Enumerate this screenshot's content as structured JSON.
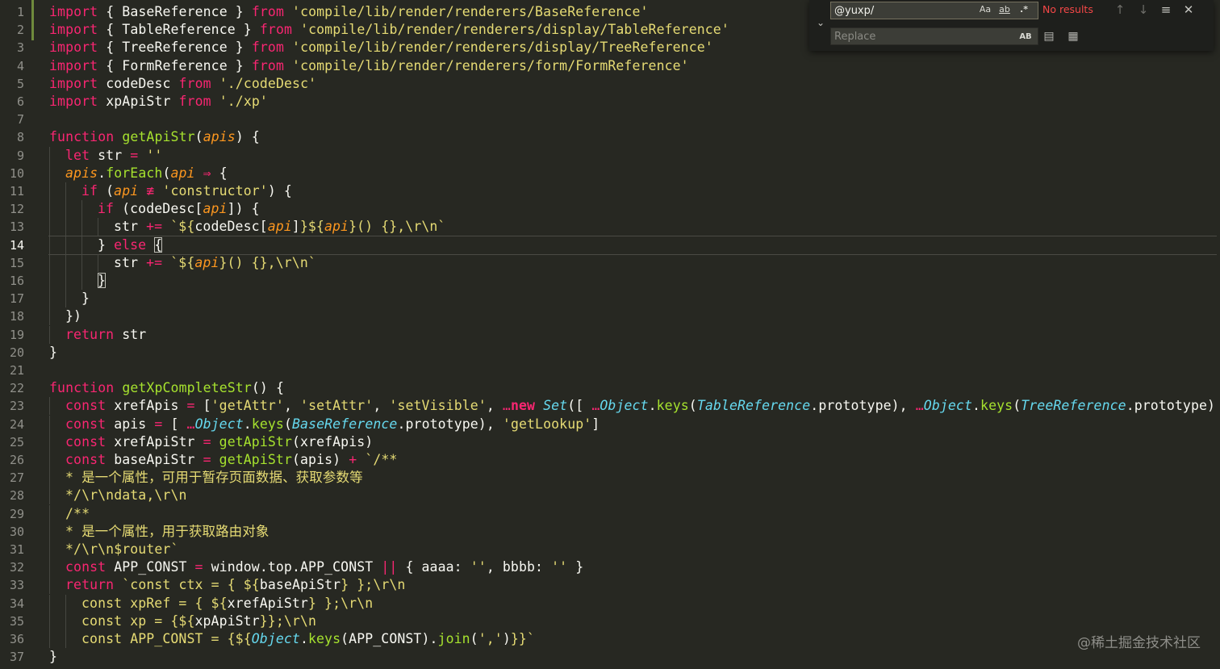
{
  "editor": {
    "active_line": 14,
    "lines": [
      {
        "n": "1",
        "indent": 0,
        "tokens": [
          [
            "k",
            "import"
          ],
          [
            "n",
            " { BaseReference } "
          ],
          [
            "k",
            "from"
          ],
          [
            "n",
            " "
          ],
          [
            "s",
            "'compile/lib/render/renderers/BaseReference'"
          ]
        ]
      },
      {
        "n": "2",
        "indent": 0,
        "tokens": [
          [
            "k",
            "import"
          ],
          [
            "n",
            " { TableReference } "
          ],
          [
            "k",
            "from"
          ],
          [
            "n",
            " "
          ],
          [
            "s",
            "'compile/lib/render/renderers/display/TableReference'"
          ]
        ]
      },
      {
        "n": "3",
        "indent": 0,
        "tokens": [
          [
            "k",
            "import"
          ],
          [
            "n",
            " { TreeReference } "
          ],
          [
            "k",
            "from"
          ],
          [
            "n",
            " "
          ],
          [
            "s",
            "'compile/lib/render/renderers/display/TreeReference'"
          ]
        ]
      },
      {
        "n": "4",
        "indent": 0,
        "tokens": [
          [
            "k",
            "import"
          ],
          [
            "n",
            " { FormReference } "
          ],
          [
            "k",
            "from"
          ],
          [
            "n",
            " "
          ],
          [
            "s",
            "'compile/lib/render/renderers/form/FormReference'"
          ]
        ]
      },
      {
        "n": "5",
        "indent": 0,
        "tokens": [
          [
            "k",
            "import"
          ],
          [
            "n",
            " codeDesc "
          ],
          [
            "k",
            "from"
          ],
          [
            "n",
            " "
          ],
          [
            "s",
            "'./codeDesc'"
          ]
        ]
      },
      {
        "n": "6",
        "indent": 0,
        "tokens": [
          [
            "k",
            "import"
          ],
          [
            "n",
            " xpApiStr "
          ],
          [
            "k",
            "from"
          ],
          [
            "n",
            " "
          ],
          [
            "s",
            "'./xp'"
          ]
        ]
      },
      {
        "n": "7",
        "indent": 0,
        "tokens": []
      },
      {
        "n": "8",
        "indent": 0,
        "tokens": [
          [
            "k",
            "function"
          ],
          [
            "n",
            " "
          ],
          [
            "f",
            "getApiStr"
          ],
          [
            "n",
            "("
          ],
          [
            "p",
            "apis"
          ],
          [
            "n",
            ") {"
          ]
        ]
      },
      {
        "n": "9",
        "indent": 1,
        "tokens": [
          [
            "k",
            "let"
          ],
          [
            "n",
            " str "
          ],
          [
            "k",
            "="
          ],
          [
            "n",
            " "
          ],
          [
            "s",
            "''"
          ]
        ]
      },
      {
        "n": "10",
        "indent": 1,
        "tokens": [
          [
            "p",
            "apis"
          ],
          [
            "n",
            "."
          ],
          [
            "f",
            "forEach"
          ],
          [
            "n",
            "("
          ],
          [
            "p",
            "api"
          ],
          [
            "n",
            " "
          ],
          [
            "k",
            "⇒"
          ],
          [
            "n",
            " {"
          ]
        ]
      },
      {
        "n": "11",
        "indent": 2,
        "tokens": [
          [
            "k",
            "if"
          ],
          [
            "n",
            " ("
          ],
          [
            "p",
            "api"
          ],
          [
            "n",
            " "
          ],
          [
            "k",
            "≢"
          ],
          [
            "n",
            " "
          ],
          [
            "s",
            "'constructor'"
          ],
          [
            "n",
            ") {"
          ]
        ]
      },
      {
        "n": "12",
        "indent": 3,
        "tokens": [
          [
            "k",
            "if"
          ],
          [
            "n",
            " (codeDesc["
          ],
          [
            "p",
            "api"
          ],
          [
            "n",
            "]) {"
          ]
        ]
      },
      {
        "n": "13",
        "indent": 4,
        "tokens": [
          [
            "n",
            "str "
          ],
          [
            "k",
            "+="
          ],
          [
            "n",
            " "
          ],
          [
            "s",
            "`${"
          ],
          [
            "n",
            "codeDesc["
          ],
          [
            "p",
            "api"
          ],
          [
            "n",
            "]"
          ],
          [
            "s",
            "}${"
          ],
          [
            "p",
            "api"
          ],
          [
            "s",
            "}() {},\\r\\n`"
          ]
        ]
      },
      {
        "n": "14",
        "indent": 3,
        "tokens": [
          [
            "n",
            "} "
          ],
          [
            "k",
            "else"
          ],
          [
            "n",
            " {"
          ]
        ]
      },
      {
        "n": "15",
        "indent": 4,
        "tokens": [
          [
            "n",
            "str "
          ],
          [
            "k",
            "+="
          ],
          [
            "n",
            " "
          ],
          [
            "s",
            "`${"
          ],
          [
            "p",
            "api"
          ],
          [
            "s",
            "}() {},\\r\\n`"
          ]
        ]
      },
      {
        "n": "16",
        "indent": 3,
        "tokens": [
          [
            "n",
            "}"
          ]
        ]
      },
      {
        "n": "17",
        "indent": 2,
        "tokens": [
          [
            "n",
            "}"
          ]
        ]
      },
      {
        "n": "18",
        "indent": 1,
        "tokens": [
          [
            "n",
            "})"
          ]
        ]
      },
      {
        "n": "19",
        "indent": 1,
        "tokens": [
          [
            "k",
            "return"
          ],
          [
            "n",
            " str"
          ]
        ]
      },
      {
        "n": "20",
        "indent": 0,
        "tokens": [
          [
            "n",
            "}"
          ]
        ]
      },
      {
        "n": "21",
        "indent": 0,
        "tokens": []
      },
      {
        "n": "22",
        "indent": 0,
        "tokens": [
          [
            "k",
            "function"
          ],
          [
            "n",
            " "
          ],
          [
            "f",
            "getXpCompleteStr"
          ],
          [
            "n",
            "() {"
          ]
        ]
      },
      {
        "n": "23",
        "indent": 1,
        "tokens": [
          [
            "k",
            "const"
          ],
          [
            "n",
            " xrefApis "
          ],
          [
            "k",
            "="
          ],
          [
            "n",
            " ["
          ],
          [
            "s",
            "'getAttr'"
          ],
          [
            "n",
            ", "
          ],
          [
            "s",
            "'setAttr'"
          ],
          [
            "n",
            ", "
          ],
          [
            "s",
            "'setVisible'"
          ],
          [
            "n",
            ", "
          ],
          [
            "k",
            "…"
          ],
          [
            "b",
            "new"
          ],
          [
            "n",
            " "
          ],
          [
            "c",
            "Set"
          ],
          [
            "n",
            "([ "
          ],
          [
            "k",
            "…"
          ],
          [
            "c",
            "Object"
          ],
          [
            "n",
            "."
          ],
          [
            "f",
            "keys"
          ],
          [
            "n",
            "("
          ],
          [
            "c",
            "TableReference"
          ],
          [
            "n",
            ".prototype), "
          ],
          [
            "k",
            "…"
          ],
          [
            "c",
            "Object"
          ],
          [
            "n",
            "."
          ],
          [
            "f",
            "keys"
          ],
          [
            "n",
            "("
          ],
          [
            "c",
            "TreeReference"
          ],
          [
            "n",
            ".prototype)"
          ]
        ]
      },
      {
        "n": "24",
        "indent": 1,
        "tokens": [
          [
            "k",
            "const"
          ],
          [
            "n",
            " apis "
          ],
          [
            "k",
            "="
          ],
          [
            "n",
            " [ "
          ],
          [
            "k",
            "…"
          ],
          [
            "c",
            "Object"
          ],
          [
            "n",
            "."
          ],
          [
            "f",
            "keys"
          ],
          [
            "n",
            "("
          ],
          [
            "c",
            "BaseReference"
          ],
          [
            "n",
            ".prototype), "
          ],
          [
            "s",
            "'getLookup'"
          ],
          [
            "n",
            "]"
          ]
        ]
      },
      {
        "n": "25",
        "indent": 1,
        "tokens": [
          [
            "k",
            "const"
          ],
          [
            "n",
            " xrefApiStr "
          ],
          [
            "k",
            "="
          ],
          [
            "n",
            " "
          ],
          [
            "f",
            "getApiStr"
          ],
          [
            "n",
            "(xrefApis)"
          ]
        ]
      },
      {
        "n": "26",
        "indent": 1,
        "tokens": [
          [
            "k",
            "const"
          ],
          [
            "n",
            " baseApiStr "
          ],
          [
            "k",
            "="
          ],
          [
            "n",
            " "
          ],
          [
            "f",
            "getApiStr"
          ],
          [
            "n",
            "(apis) "
          ],
          [
            "k",
            "+"
          ],
          [
            "n",
            " "
          ],
          [
            "s",
            "`/**"
          ]
        ]
      },
      {
        "n": "27",
        "indent": 1,
        "tokens": [
          [
            "s",
            "* 是一个属性，可用于暂存页面数据、获取参数等"
          ]
        ]
      },
      {
        "n": "28",
        "indent": 1,
        "tokens": [
          [
            "s",
            "*/\\r\\ndata,\\r\\n"
          ]
        ]
      },
      {
        "n": "29",
        "indent": 1,
        "tokens": [
          [
            "s",
            "/**"
          ]
        ]
      },
      {
        "n": "30",
        "indent": 1,
        "tokens": [
          [
            "s",
            "* 是一个属性，用于获取路由对象"
          ]
        ]
      },
      {
        "n": "31",
        "indent": 1,
        "tokens": [
          [
            "s",
            "*/\\r\\n$router`"
          ]
        ]
      },
      {
        "n": "32",
        "indent": 1,
        "tokens": [
          [
            "k",
            "const"
          ],
          [
            "n",
            " APP_CONST "
          ],
          [
            "k",
            "="
          ],
          [
            "n",
            " window.top.APP_CONST "
          ],
          [
            "k",
            "||"
          ],
          [
            "n",
            " { aaaa: "
          ],
          [
            "s",
            "''"
          ],
          [
            "n",
            ", bbbb: "
          ],
          [
            "s",
            "''"
          ],
          [
            "n",
            " }"
          ]
        ]
      },
      {
        "n": "33",
        "indent": 1,
        "tokens": [
          [
            "k",
            "return"
          ],
          [
            "n",
            " "
          ],
          [
            "s",
            "`const ctx = { "
          ],
          [
            "s",
            "${"
          ],
          [
            "n",
            "baseApiStr"
          ],
          [
            "s",
            "} };\\r\\n"
          ]
        ]
      },
      {
        "n": "34",
        "indent": 2,
        "tokens": [
          [
            "s",
            "const xpRef = { "
          ],
          [
            "s",
            "${"
          ],
          [
            "n",
            "xrefApiStr"
          ],
          [
            "s",
            "} };\\r\\n"
          ]
        ]
      },
      {
        "n": "35",
        "indent": 2,
        "tokens": [
          [
            "s",
            "const xp = {"
          ],
          [
            "s",
            "${"
          ],
          [
            "n",
            "xpApiStr"
          ],
          [
            "s",
            "}};\\r\\n"
          ]
        ]
      },
      {
        "n": "36",
        "indent": 2,
        "tokens": [
          [
            "s",
            "const APP_CONST = {"
          ],
          [
            "s",
            "${"
          ],
          [
            "c",
            "Object"
          ],
          [
            "n",
            "."
          ],
          [
            "f",
            "keys"
          ],
          [
            "n",
            "(APP_CONST)."
          ],
          [
            "f",
            "join"
          ],
          [
            "n",
            "("
          ],
          [
            "s",
            "','"
          ],
          [
            "n",
            ")"
          ],
          [
            "s",
            "}}`"
          ]
        ]
      },
      {
        "n": "37",
        "indent": 0,
        "tokens": [
          [
            "n",
            "}"
          ]
        ]
      }
    ]
  },
  "find_widget": {
    "toggle_icon": "chevron-down-icon",
    "find_value": "@yuxp/",
    "replace_placeholder": "Replace",
    "match_case_label": "Aa",
    "whole_word_label": "ab",
    "regex_label": ".*",
    "status": "No results",
    "prev_icon": "arrow-up-icon",
    "next_icon": "arrow-down-icon",
    "selection_icon": "find-in-selection-icon",
    "close_icon": "close-icon",
    "preserve_case_label": "AB"
  },
  "watermark": "@稀土掘金技术社区"
}
